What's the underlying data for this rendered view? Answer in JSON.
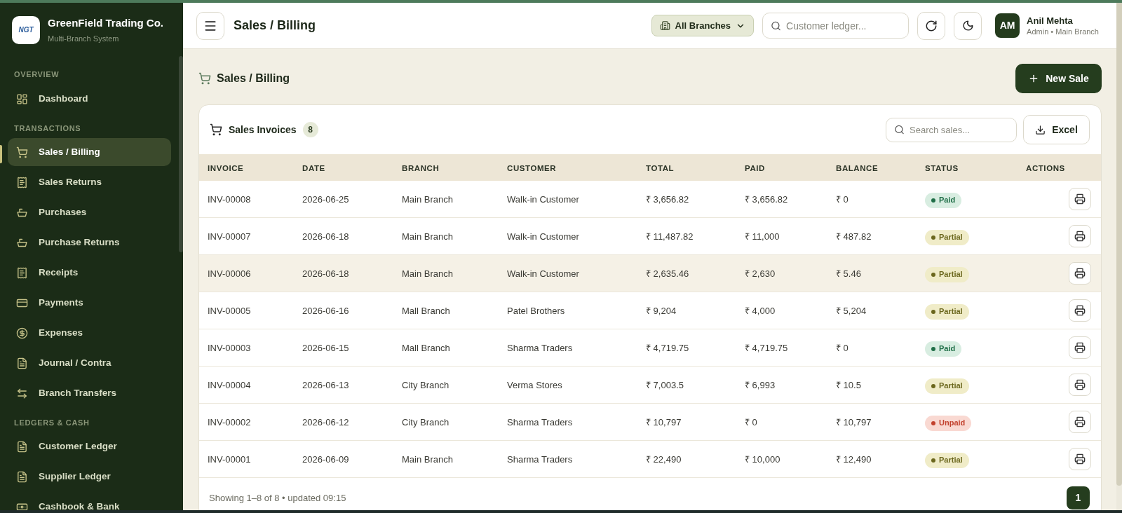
{
  "brand": {
    "logo_text": "NGT",
    "name": "GreenField Trading Co.",
    "subtitle": "Multi-Branch System"
  },
  "sidebar": {
    "sections": [
      {
        "title": "OVERVIEW",
        "items": [
          {
            "label": "Dashboard",
            "selected": false
          }
        ]
      },
      {
        "title": "TRANSACTIONS",
        "items": [
          {
            "label": "Sales / Billing",
            "selected": true
          },
          {
            "label": "Sales Returns",
            "selected": false
          },
          {
            "label": "Purchases",
            "selected": false
          },
          {
            "label": "Purchase Returns",
            "selected": false
          },
          {
            "label": "Receipts",
            "selected": false
          },
          {
            "label": "Payments",
            "selected": false
          },
          {
            "label": "Expenses",
            "selected": false
          },
          {
            "label": "Journal / Contra",
            "selected": false
          },
          {
            "label": "Branch Transfers",
            "selected": false
          }
        ]
      },
      {
        "title": "LEDGERS & CASH",
        "items": [
          {
            "label": "Customer Ledger",
            "selected": false
          },
          {
            "label": "Supplier Ledger",
            "selected": false
          },
          {
            "label": "Cashbook & Bank",
            "selected": false
          }
        ]
      }
    ]
  },
  "header": {
    "title": "Sales / Billing",
    "branch_filter": "All Branches",
    "search": {
      "placeholder": "Customer ledger..."
    },
    "user": {
      "initials": "AM",
      "name": "Anil Mehta",
      "role": "Admin • Main Branch"
    }
  },
  "page": {
    "title": "Sales / Billing",
    "new_button": "New Sale"
  },
  "invoices": {
    "title": "Sales Invoices",
    "count": "8",
    "search": {
      "placeholder": "Search sales..."
    },
    "export_button": "Excel",
    "columns": [
      "INVOICE",
      "DATE",
      "BRANCH",
      "CUSTOMER",
      "TOTAL",
      "PAID",
      "BALANCE",
      "STATUS",
      "ACTIONS"
    ],
    "rows": [
      {
        "invoice": "INV-00008",
        "date": "2026-06-25",
        "branch": "Main Branch",
        "customer": "Walk-in Customer",
        "total": "₹ 3,656.82",
        "paid": "₹ 3,656.82",
        "balance": "₹ 0",
        "status": {
          "label": "Paid",
          "kind": "paid"
        },
        "hovered": false
      },
      {
        "invoice": "INV-00007",
        "date": "2026-06-18",
        "branch": "Main Branch",
        "customer": "Walk-in Customer",
        "total": "₹ 11,487.82",
        "paid": "₹ 11,000",
        "balance": "₹ 487.82",
        "status": {
          "label": "Partial",
          "kind": "partial"
        },
        "hovered": false
      },
      {
        "invoice": "INV-00006",
        "date": "2026-06-18",
        "branch": "Main Branch",
        "customer": "Walk-in Customer",
        "total": "₹ 2,635.46",
        "paid": "₹ 2,630",
        "balance": "₹ 5.46",
        "status": {
          "label": "Partial",
          "kind": "partial"
        },
        "hovered": true
      },
      {
        "invoice": "INV-00005",
        "date": "2026-06-16",
        "branch": "Mall Branch",
        "customer": "Patel Brothers",
        "total": "₹ 9,204",
        "paid": "₹ 4,000",
        "balance": "₹ 5,204",
        "status": {
          "label": "Partial",
          "kind": "partial"
        },
        "hovered": false
      },
      {
        "invoice": "INV-00003",
        "date": "2026-06-15",
        "branch": "Mall Branch",
        "customer": "Sharma Traders",
        "total": "₹ 4,719.75",
        "paid": "₹ 4,719.75",
        "balance": "₹ 0",
        "status": {
          "label": "Paid",
          "kind": "paid"
        },
        "hovered": false
      },
      {
        "invoice": "INV-00004",
        "date": "2026-06-13",
        "branch": "City Branch",
        "customer": "Verma Stores",
        "total": "₹ 7,003.5",
        "paid": "₹ 6,993",
        "balance": "₹ 10.5",
        "status": {
          "label": "Partial",
          "kind": "partial"
        },
        "hovered": false
      },
      {
        "invoice": "INV-00002",
        "date": "2026-06-12",
        "branch": "City Branch",
        "customer": "Sharma Traders",
        "total": "₹ 10,797",
        "paid": "₹ 0",
        "balance": "₹ 10,797",
        "status": {
          "label": "Unpaid",
          "kind": "unpaid"
        },
        "hovered": false
      },
      {
        "invoice": "INV-00001",
        "date": "2026-06-09",
        "branch": "Main Branch",
        "customer": "Sharma Traders",
        "total": "₹ 22,490",
        "paid": "₹ 10,000",
        "balance": "₹ 12,490",
        "status": {
          "label": "Partial",
          "kind": "partial"
        },
        "hovered": false
      }
    ],
    "footer": {
      "summary": "Showing 1–8 of 8 • updated 09:15",
      "pages": [
        {
          "label": "1",
          "selected": true
        }
      ]
    }
  }
}
